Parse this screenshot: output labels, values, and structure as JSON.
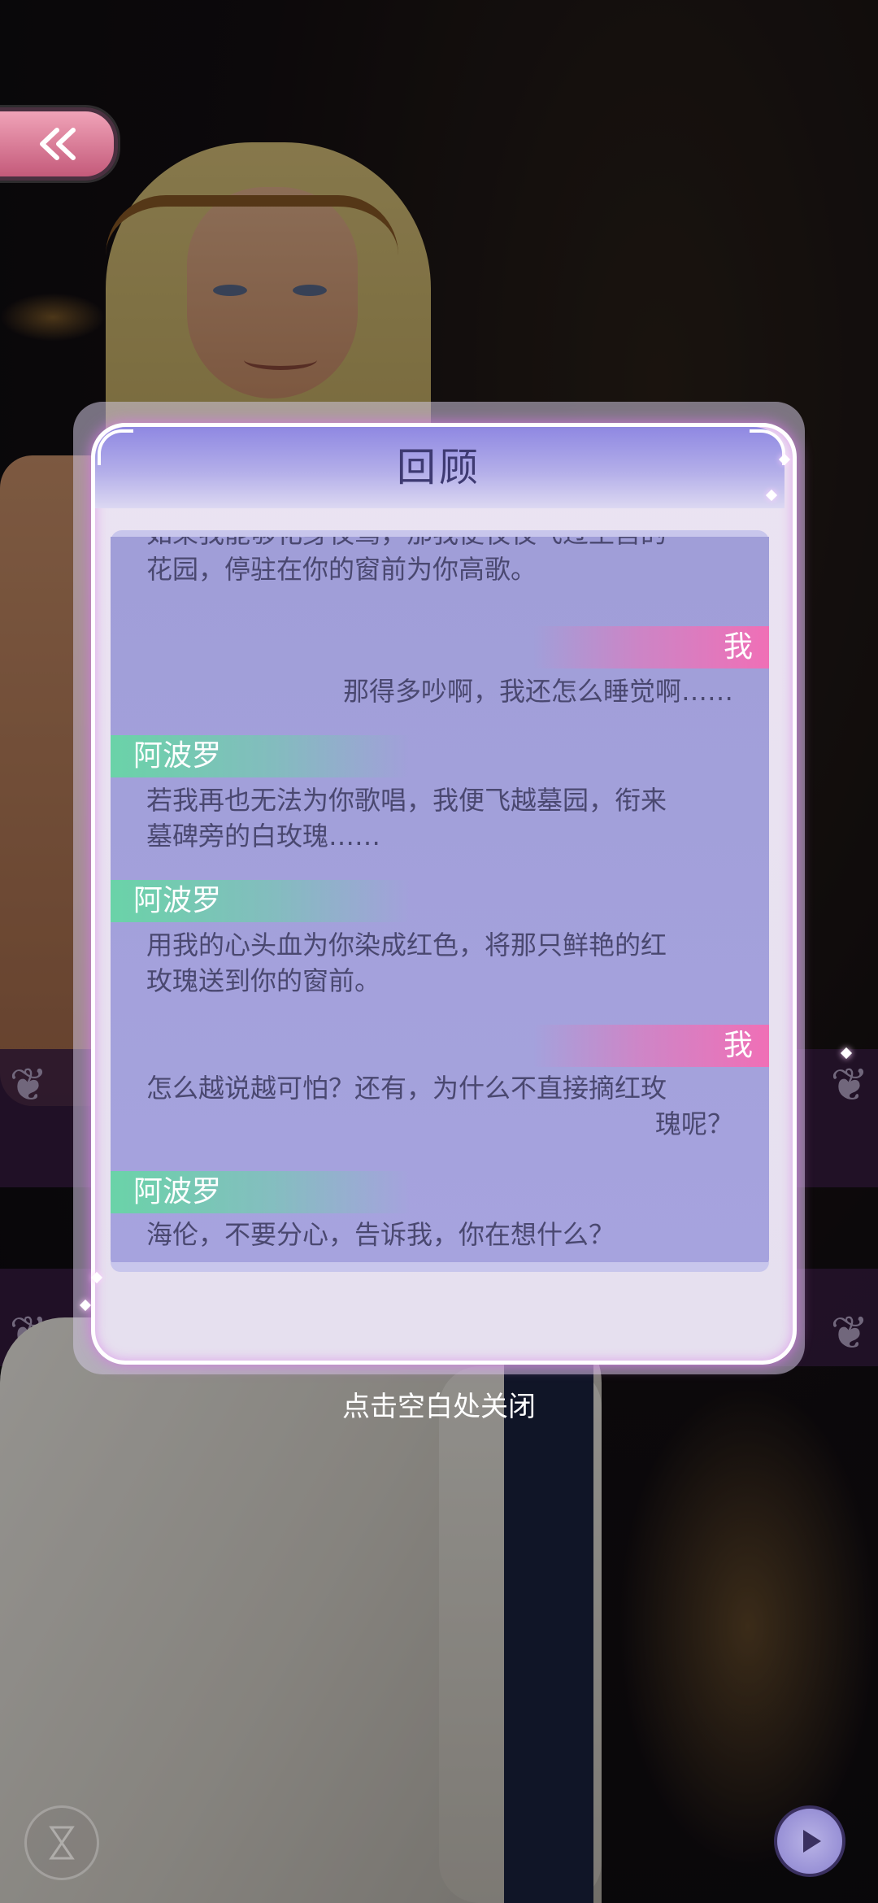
{
  "modal": {
    "title": "回顾",
    "close_hint": "点击空白处关闭"
  },
  "dialogue": [
    {
      "speaker": "",
      "side": "left",
      "text_lines": [
        "如果我能够化身夜莺，那我便夜夜飞过王宫的",
        "花园，停驻在你的窗前为你高歌。"
      ]
    },
    {
      "speaker": "我",
      "side": "right",
      "text_lines": [
        "那得多吵啊，我还怎么睡觉啊……"
      ]
    },
    {
      "speaker": "阿波罗",
      "side": "left",
      "text_lines": [
        "若我再也无法为你歌唱，我便飞越墓园，衔来",
        "墓碑旁的白玫瑰……"
      ]
    },
    {
      "speaker": "阿波罗",
      "side": "left",
      "text_lines": [
        "用我的心头血为你染成红色，将那只鲜艳的红",
        "玫瑰送到你的窗前。"
      ]
    },
    {
      "speaker": "我",
      "side": "right",
      "text_lines": [
        "怎么越说越可怕？还有，为什么不直接摘红玫",
        "瑰呢？"
      ]
    },
    {
      "speaker": "阿波罗",
      "side": "left",
      "text_lines": [
        "海伦，不要分心，告诉我，你在想什么？"
      ]
    }
  ],
  "colors": {
    "header_purple": "#8f88e2",
    "content_bg": "#a09ed8",
    "apollo_tag": "#6ad3a8",
    "me_tag": "#f06fb6",
    "text": "#4a4870"
  },
  "icons": {
    "back": "double-chevron-left-icon",
    "play": "play-icon",
    "hourglass": "hourglass-icon"
  }
}
